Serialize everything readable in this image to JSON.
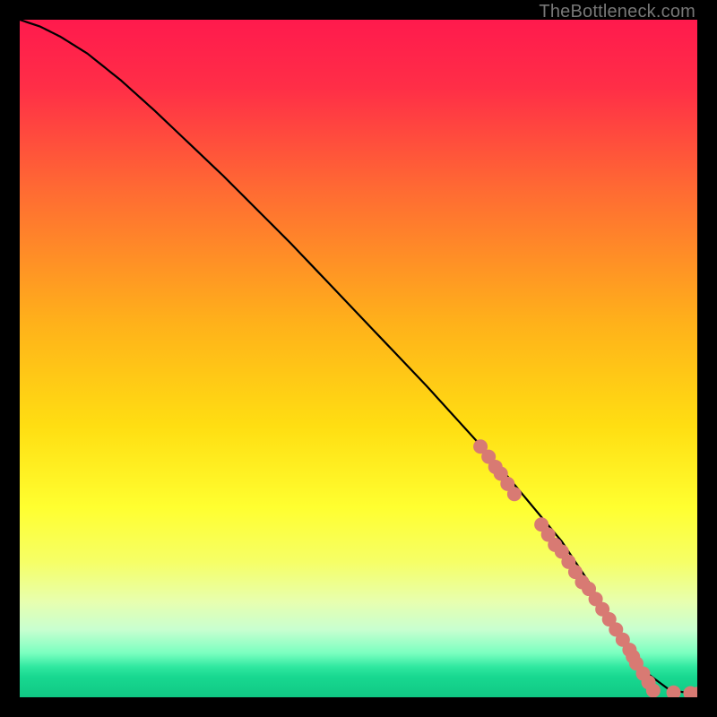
{
  "watermark": "TheBottleneck.com",
  "chart_data": {
    "type": "line",
    "title": "",
    "xlabel": "",
    "ylabel": "",
    "xlim": [
      0,
      100
    ],
    "ylim": [
      0,
      100
    ],
    "grid": false,
    "background_gradient": [
      {
        "offset": 0.0,
        "color": "#ff1a4d"
      },
      {
        "offset": 0.1,
        "color": "#ff2e47"
      },
      {
        "offset": 0.25,
        "color": "#ff6a33"
      },
      {
        "offset": 0.45,
        "color": "#ffb21a"
      },
      {
        "offset": 0.6,
        "color": "#ffde12"
      },
      {
        "offset": 0.72,
        "color": "#ffff30"
      },
      {
        "offset": 0.8,
        "color": "#f6ff66"
      },
      {
        "offset": 0.86,
        "color": "#e7ffb0"
      },
      {
        "offset": 0.9,
        "color": "#c8ffd0"
      },
      {
        "offset": 0.935,
        "color": "#7affc0"
      },
      {
        "offset": 0.955,
        "color": "#30e8a0"
      },
      {
        "offset": 0.97,
        "color": "#18d890"
      },
      {
        "offset": 1.0,
        "color": "#10c884"
      }
    ],
    "series": [
      {
        "name": "bottleneck-curve",
        "x": [
          0,
          3,
          6,
          10,
          15,
          20,
          30,
          40,
          50,
          60,
          70,
          80,
          84,
          88,
          92,
          96,
          100
        ],
        "y": [
          100,
          99,
          97.5,
          95,
          91,
          86.5,
          77,
          67,
          56.5,
          46,
          35,
          23,
          17,
          10,
          4,
          1,
          0.5
        ]
      }
    ],
    "highlight_points": {
      "name": "highlight-dots",
      "color": "#d87a73",
      "radius_px": 8,
      "points": [
        {
          "x": 68.0,
          "y": 37.0
        },
        {
          "x": 69.2,
          "y": 35.5
        },
        {
          "x": 70.2,
          "y": 34.0
        },
        {
          "x": 71.0,
          "y": 33.0
        },
        {
          "x": 72.0,
          "y": 31.5
        },
        {
          "x": 73.0,
          "y": 30.0
        },
        {
          "x": 77.0,
          "y": 25.5
        },
        {
          "x": 78.0,
          "y": 24.0
        },
        {
          "x": 79.0,
          "y": 22.5
        },
        {
          "x": 80.0,
          "y": 21.5
        },
        {
          "x": 81.0,
          "y": 20.0
        },
        {
          "x": 82.0,
          "y": 18.5
        },
        {
          "x": 83.0,
          "y": 17.0
        },
        {
          "x": 84.0,
          "y": 16.0
        },
        {
          "x": 85.0,
          "y": 14.5
        },
        {
          "x": 86.0,
          "y": 13.0
        },
        {
          "x": 87.0,
          "y": 11.5
        },
        {
          "x": 88.0,
          "y": 10.0
        },
        {
          "x": 89.0,
          "y": 8.5
        },
        {
          "x": 90.0,
          "y": 7.0
        },
        {
          "x": 90.5,
          "y": 6.0
        },
        {
          "x": 91.0,
          "y": 5.0
        },
        {
          "x": 92.0,
          "y": 3.5
        },
        {
          "x": 92.8,
          "y": 2.2
        },
        {
          "x": 93.5,
          "y": 1.0
        },
        {
          "x": 96.5,
          "y": 0.7
        },
        {
          "x": 99.0,
          "y": 0.6
        },
        {
          "x": 100.0,
          "y": 0.5
        }
      ]
    }
  }
}
